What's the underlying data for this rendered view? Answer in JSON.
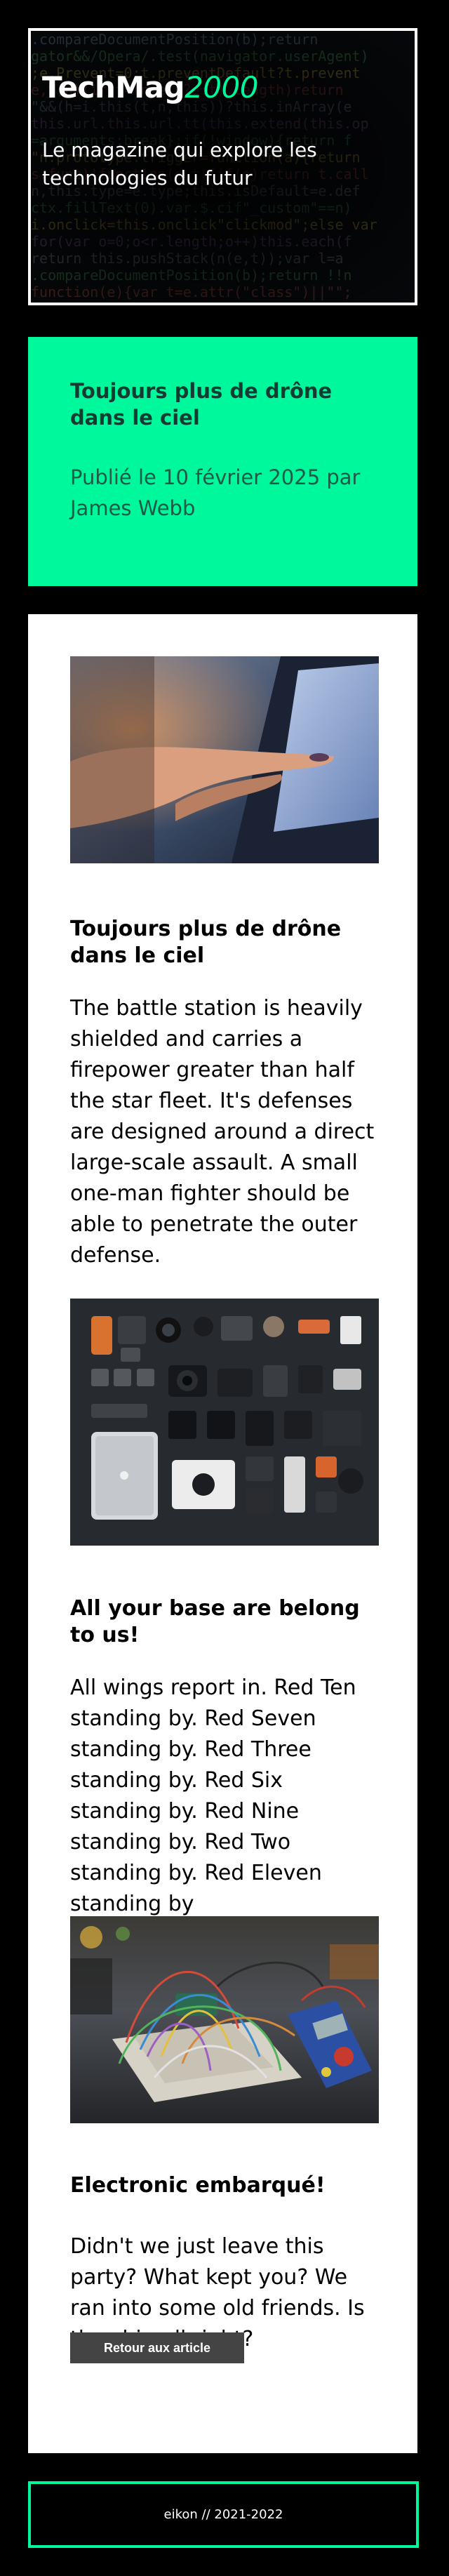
{
  "header": {
    "brand_main": "TechMag",
    "brand_accent": "2000",
    "tagline": "Le magazine qui explore les technologies du futur"
  },
  "article_info": {
    "title": "Toujours plus de drône dans le ciel",
    "meta": "Publié le 10 février 2025 par James Webb"
  },
  "articles": [
    {
      "image": "hand-touching-tablet-photo",
      "title": "Toujours plus de drône dans le ciel",
      "body": "The battle station is heavily shielded and carries a firepower greater than half the star fleet. It's defenses are designed around a direct large-scale assault. A small one-man fighter should be able to penetrate the outer defense."
    },
    {
      "image": "camera-gear-flatlay-photo",
      "title": "All your base are belong to us!",
      "body": "All wings report in. Red Ten standing by. Red Seven standing by. Red Three standing by. Red Six standing by. Red Nine standing by. Red Two standing by. Red Eleven standing by"
    },
    {
      "image": "electronics-breadboard-photo",
      "title": "Electronic embarqué!",
      "body": "Didn't we just leave this party? What kept you? We ran into some old friends. Is the ship all right?"
    }
  ],
  "back_button_label": "Retour aux article",
  "footer": {
    "text": "eikon // 2021-2022"
  },
  "colors": {
    "accent": "#00f79b",
    "page_background": "#000000",
    "button": "#444444"
  }
}
